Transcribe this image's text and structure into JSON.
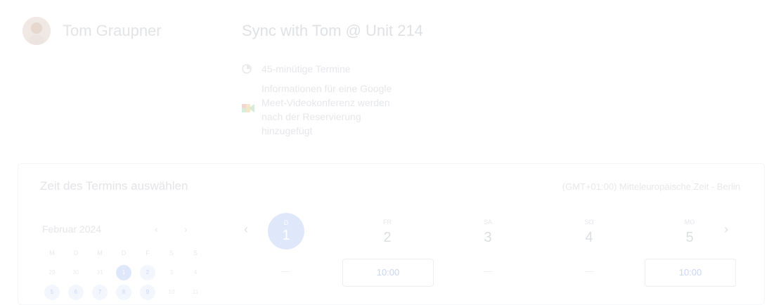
{
  "host": {
    "name": "Tom Graupner"
  },
  "event": {
    "title": "Sync with Tom @ Unit 214",
    "duration": "45-minütige Termine",
    "meet_info": "Informationen für eine Google Meet-Videokonferenz werden nach der Reservierung hinzugefügt"
  },
  "booking": {
    "section_title": "Zeit des Termins auswählen",
    "timezone": "(GMT+01:00) Mitteleuropäische Zeit - Berlin"
  },
  "mini_calendar": {
    "month": "Februar 2024",
    "prev": "‹",
    "next": "›",
    "weekdays": [
      "M",
      "D",
      "M",
      "D",
      "F",
      "S",
      "S"
    ],
    "rows": [
      [
        "29",
        "30",
        "31",
        "1",
        "2",
        "3",
        "4"
      ],
      [
        "5",
        "6",
        "7",
        "8",
        "9",
        "10",
        "11"
      ]
    ]
  },
  "days": [
    {
      "dow": "D",
      "num": "1",
      "slot": "—"
    },
    {
      "dow": "FR",
      "num": "2",
      "slot": "10:00"
    },
    {
      "dow": "SA",
      "num": "3",
      "slot": "—"
    },
    {
      "dow": "SO",
      "num": "4",
      "slot": "—"
    },
    {
      "dow": "MO",
      "num": "5",
      "slot": "10:00"
    }
  ],
  "nav": {
    "prev": "‹",
    "next": "›"
  },
  "colors": {
    "accent": "#dfe7fb",
    "text": "#e3e5e8"
  }
}
